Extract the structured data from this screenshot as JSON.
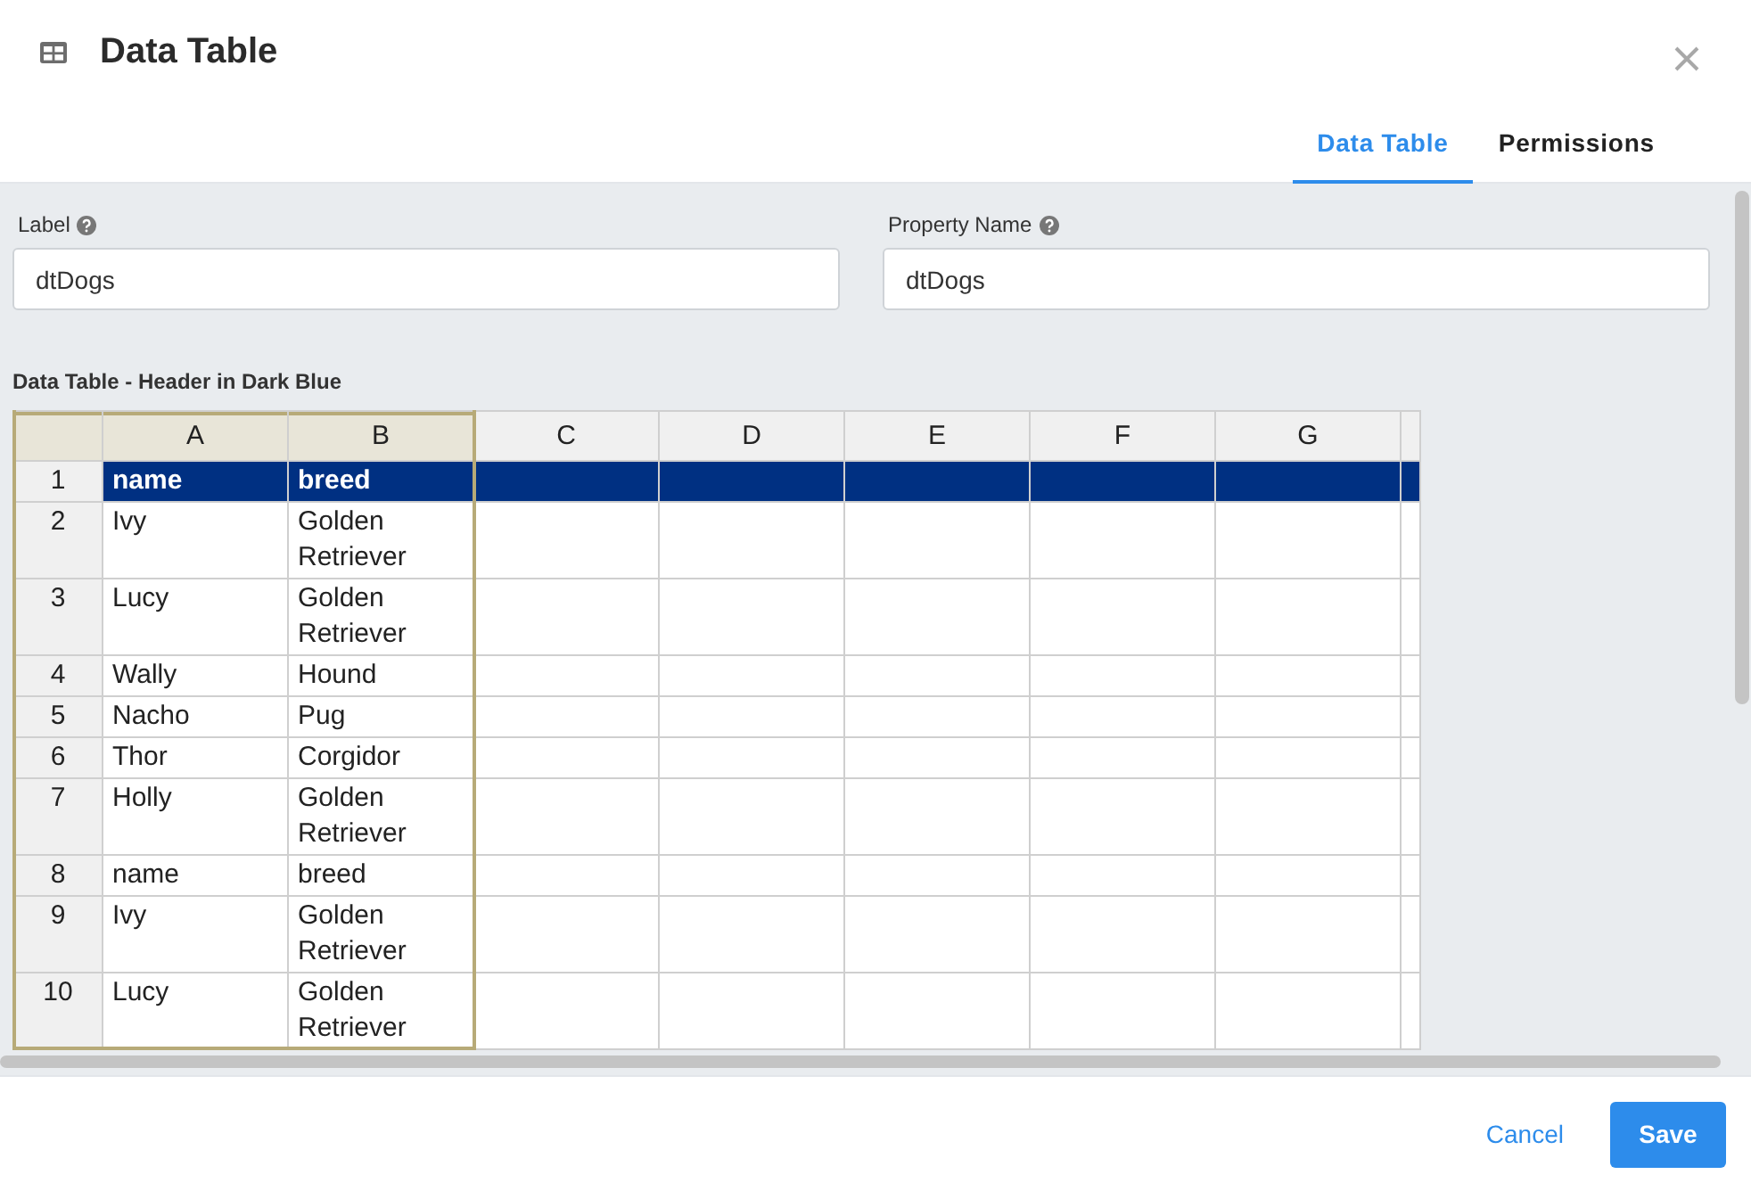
{
  "dialog": {
    "title": "Data Table"
  },
  "tabs": [
    {
      "label": "Data Table",
      "selected": true
    },
    {
      "label": "Permissions",
      "selected": false
    }
  ],
  "fields": [
    {
      "label": "Label",
      "value": "dtDogs"
    },
    {
      "label": "Property Name",
      "value": "dtDogs"
    }
  ],
  "section_title": "Data Table - Header in Dark Blue",
  "grid": {
    "columns": [
      {
        "label": "A",
        "selected": true
      },
      {
        "label": "B",
        "selected": true
      },
      {
        "label": "C",
        "selected": false
      },
      {
        "label": "D",
        "selected": false
      },
      {
        "label": "E",
        "selected": false
      },
      {
        "label": "F",
        "selected": false
      },
      {
        "label": "G",
        "selected": false
      }
    ],
    "rows": [
      {
        "number": "1",
        "highlighted": true,
        "cells": [
          "name",
          "breed"
        ]
      },
      {
        "number": "2",
        "highlighted": false,
        "cells": [
          "Ivy",
          "Golden Retriever"
        ]
      },
      {
        "number": "3",
        "highlighted": false,
        "cells": [
          "Lucy",
          "Golden Retriever"
        ]
      },
      {
        "number": "4",
        "highlighted": false,
        "cells": [
          "Wally",
          "Hound"
        ]
      },
      {
        "number": "5",
        "highlighted": false,
        "cells": [
          "Nacho",
          "Pug"
        ]
      },
      {
        "number": "6",
        "highlighted": false,
        "cells": [
          "Thor",
          "Corgidor"
        ]
      },
      {
        "number": "7",
        "highlighted": false,
        "cells": [
          "Holly",
          "Golden Retriever"
        ]
      },
      {
        "number": "8",
        "highlighted": false,
        "cells": [
          "name",
          "breed"
        ]
      },
      {
        "number": "9",
        "highlighted": false,
        "cells": [
          "Ivy",
          "Golden Retriever"
        ]
      },
      {
        "number": "10",
        "highlighted": false,
        "cells": [
          "Lucy",
          "Golden Retriever"
        ]
      }
    ]
  },
  "buttons": [
    {
      "label": "Cancel",
      "kind": "link"
    },
    {
      "label": "Save",
      "kind": "primary"
    }
  ]
}
